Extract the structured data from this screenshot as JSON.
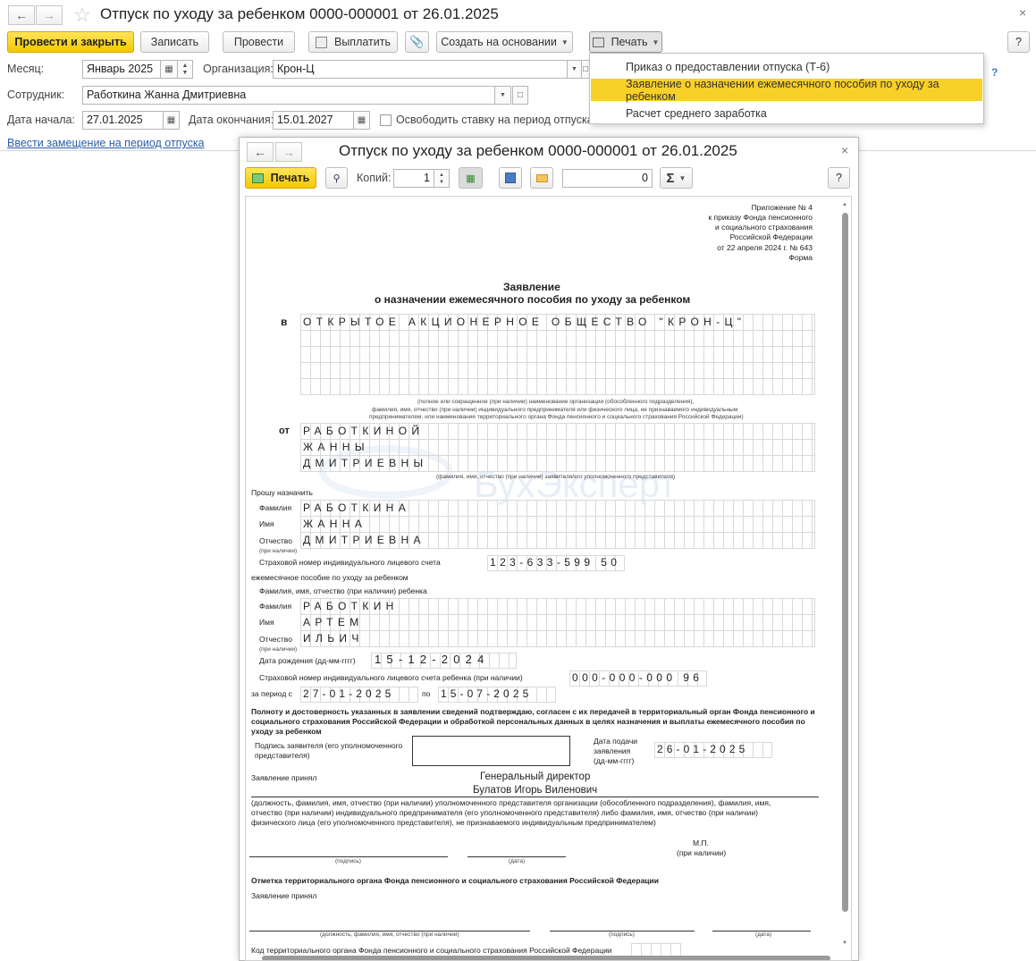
{
  "main": {
    "title": "Отпуск по уходу за ребенком 0000-000001 от 26.01.2025",
    "toolbar": {
      "post_close": "Провести и закрыть",
      "save": "Записать",
      "post": "Провести",
      "pay": "Выплатить",
      "create_based": "Создать на основании",
      "print": "Печать",
      "help": "?"
    },
    "form": {
      "month_label": "Месяц:",
      "month_value": "Январь 2025",
      "org_label": "Организация:",
      "org_value": "Крон-Ц",
      "employee_label": "Сотрудник:",
      "employee_value": "Работкина Жанна Дмитриевна",
      "start_label": "Дата начала:",
      "start_value": "27.01.2025",
      "end_label": "Дата окончания:",
      "end_value": "15.01.2027",
      "free_rate_label": "Освободить ставку на период отпуска",
      "replacement_link": "Ввести замещение на период отпуска"
    },
    "print_menu": [
      "Приказ о предоставлении отпуска (Т-6)",
      "Заявление о назначении ежемесячного пособия по уходу за ребенком",
      "Расчет среднего заработка"
    ]
  },
  "print_window": {
    "title": "Отпуск по уходу за ребенком 0000-000001 от 26.01.2025",
    "print_btn": "Печать",
    "copies_label": "Копий:",
    "copies_value": "1",
    "sum_value": "0",
    "help": "?"
  },
  "document": {
    "appendix": [
      "Приложение № 4",
      "к приказу Фонда пенсионного",
      "и социального страхования",
      "Российской Федерации",
      "от 22 апреля 2024 г. № 643",
      "Форма"
    ],
    "heading1": "Заявление",
    "heading2": "о назначении ежемесячного пособия по уходу за ребенком",
    "to_label": "в",
    "org_name": "ОТКРЫТОЕ АКЦИОНЕРНОЕ ОБЩЕСТВО \"КРОН-Ц\"",
    "org_note1": "(полное или сокращенное (при наличии) наименование организации (обособленного подразделения),",
    "org_note2": "фамилия, имя, отчество (при наличии) индивидуального предпринимателя или физического лица, не признаваемого индивидуальным",
    "org_note3": "предпринимателем, или наименование территориального органа Фонда пенсионного и социального страхования Российской Федерации)",
    "from_label": "от",
    "from_lines": [
      "РАБОТКИНОЙ",
      "ЖАННЫ",
      "ДМИТРИЕВНЫ"
    ],
    "from_note": "(фамилия, имя, отчество (при наличии) заявителя/его уполномоченного представителя)",
    "request": "Прошу назначить",
    "surname_label": "Фамилия",
    "surname": "РАБОТКИНА",
    "name_label": "Имя",
    "name": "ЖАННА",
    "patronymic_label": "Отчество",
    "if_any": "(при наличии)",
    "patronymic": "ДМИТРИЕВНА",
    "snils_label": "Страховой номер индивидуального лицевого счета",
    "snils": "123-633-599 50",
    "benefit_label": "ежемесячное пособие по уходу за ребенком",
    "child_fio_label": "Фамилия, имя, отчество (при наличии) ребенка",
    "child_surname": "РАБОТКИН",
    "child_name": "АРТЕМ",
    "child_patronymic": "ИЛЬИЧ",
    "birth_label": "Дата рождения (дд-мм-гггг)",
    "birth": "15-12-2024",
    "child_snils_label": "Страховой номер индивидуального лицевого счета ребенка (при наличии)",
    "child_snils": "000-000-000 96",
    "period_label": "за период с",
    "period_from": "27-01-2025",
    "period_to_label": "по",
    "period_to": "15-07-2025",
    "confirm": [
      "Полноту и достоверность указанных в заявлении сведений подтверждаю, согласен с их передачей в территориальный орган Фонда пенсионного и",
      "социального страхования Российской Федерации и обработкой персональных данных в целях назначения и выплаты ежемесячного пособия по",
      "уходу за ребенком"
    ],
    "sign_label": [
      "Подпись заявителя (его уполномоченного",
      "представителя)"
    ],
    "submit_date_label": [
      "Дата подачи",
      "заявления",
      "(дд-мм-гггг)"
    ],
    "submit_date": "26-01-2025",
    "accepted_label": "Заявление принял",
    "director_position": "Генеральный директор",
    "director_name": "Булатов Игорь Виленович",
    "position_note": [
      "(должность, фамилия, имя, отчество (при наличии) уполномоченного представителя организации (обособленного подразделения), фамилия, имя,",
      "отчество (при наличии) индивидуального предпринимателя (его уполномоченного представителя) либо фамилия, имя, отчество (при наличии)",
      "физического лица (его уполномоченного представителя), не признаваемого индивидуальным предпринимателем)"
    ],
    "mp": "М.П.",
    "mp_note": "(при наличии)",
    "sign_note": "(подпись)",
    "date_note": "(дата)",
    "fund_mark": "Отметка территориального органа Фонда пенсионного и социального страхования Российской Федерации",
    "accepted_label2": "Заявление принял",
    "position_fio_note": "(должность, фамилия, имя, отчество (при наличии)",
    "fund_code_label": "Код территориального органа Фонда пенсионного и социального страхования Российской Федерации",
    "watermark": "БухЭксперт"
  }
}
